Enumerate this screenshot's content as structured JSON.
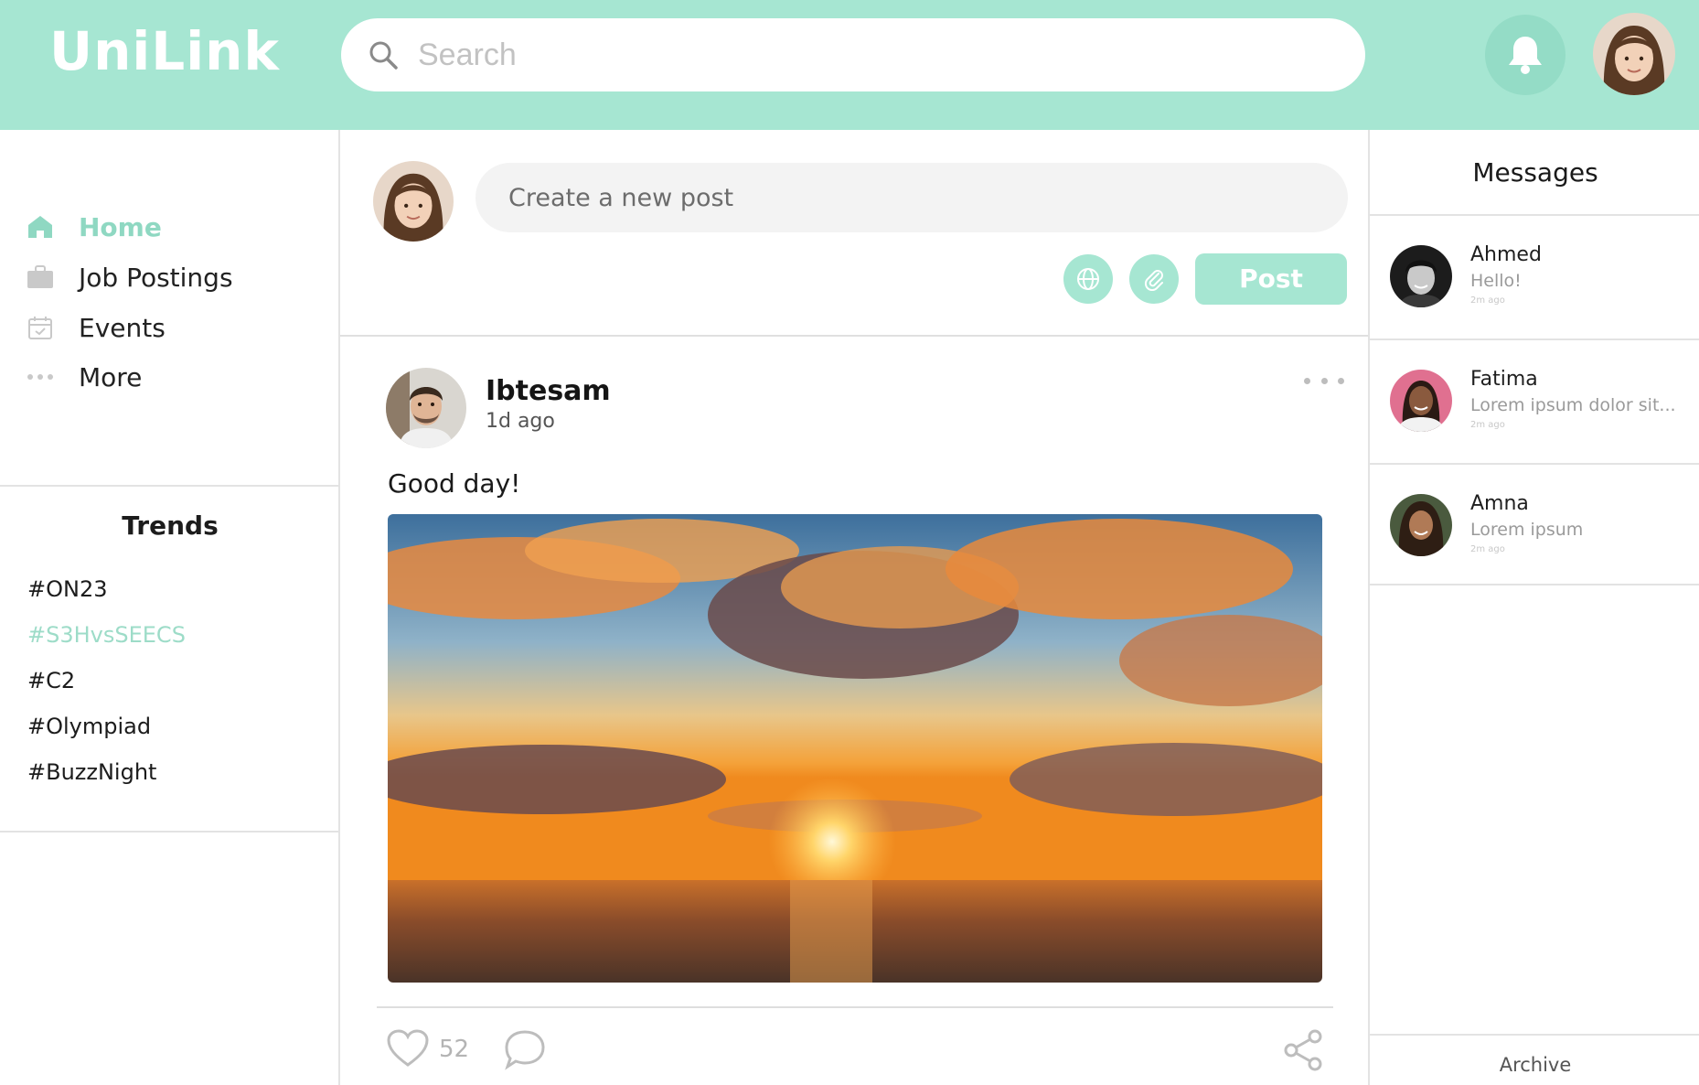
{
  "header": {
    "logo": "UniLink",
    "search_placeholder": "Search"
  },
  "icons": {
    "search": "search-icon",
    "bell": "bell-icon",
    "home": "home-icon",
    "briefcase": "briefcase-icon",
    "calendar": "calendar-icon",
    "dots": "more-dots-icon",
    "globe": "globe-icon",
    "paperclip": "paperclip-icon",
    "heart": "heart-icon",
    "comment": "comment-icon",
    "share": "share-icon"
  },
  "colors": {
    "brand": "#a6e6d2",
    "brand_dark": "#8fd8c2",
    "highlight": "#9ddcc8"
  },
  "sidebar": {
    "nav": [
      {
        "label": "Home",
        "active": true
      },
      {
        "label": "Job Postings",
        "active": false
      },
      {
        "label": "Events",
        "active": false
      },
      {
        "label": "More",
        "active": false
      }
    ],
    "trends_title": "Trends",
    "trends": [
      "#ON23",
      "#S3HvsSEECS",
      "#C2",
      "#Olympiad",
      "#BuzzNight"
    ]
  },
  "composer": {
    "placeholder": "Create a new post",
    "post_label": "Post"
  },
  "post": {
    "author": "Ibtesam",
    "time": "1d ago",
    "text": "Good day!",
    "likes": "52"
  },
  "messages": {
    "title": "Messages",
    "items": [
      {
        "name": "Ahmed",
        "text": "Hello!",
        "time": "2m ago"
      },
      {
        "name": "Fatima",
        "text": "Lorem ipsum dolor sit...",
        "time": "2m ago"
      },
      {
        "name": "Amna",
        "text": "Lorem ipsum",
        "time": "2m ago"
      }
    ],
    "archive": "Archive"
  }
}
